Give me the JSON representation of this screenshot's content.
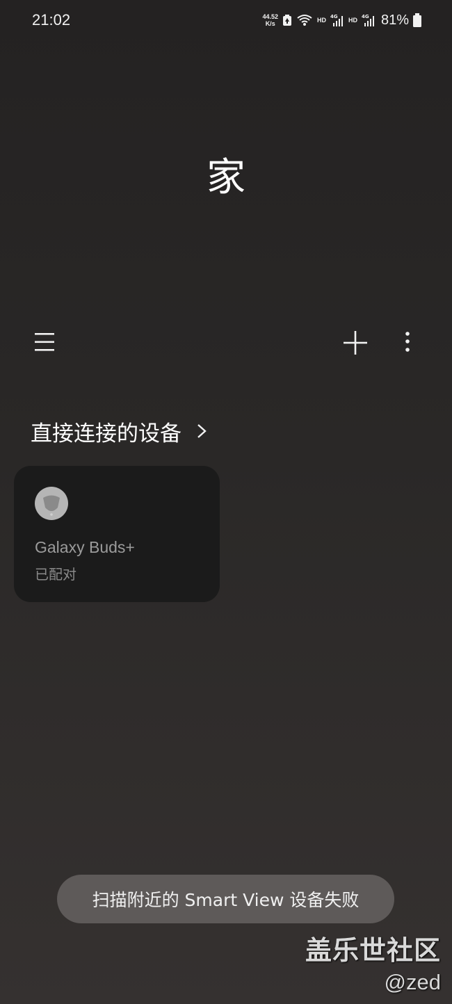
{
  "status_bar": {
    "time": "21:02",
    "net_speed_value": "44.52",
    "net_speed_unit": "K/s",
    "hd1": "HD",
    "hd2": "HD",
    "network1": "4G",
    "network2": "4G",
    "battery_percent": "81%"
  },
  "header": {
    "title": "家"
  },
  "toolbar": {
    "menu_icon": "hamburger-icon",
    "add_icon": "plus-icon",
    "more_icon": "more-vertical-icon"
  },
  "section": {
    "title": "直接连接的设备",
    "chevron_icon": "chevron-right-icon"
  },
  "devices": [
    {
      "name": "Galaxy Buds+",
      "status": "已配对",
      "icon": "earbuds-icon"
    }
  ],
  "toast": {
    "message": "扫描附近的 Smart View 设备失败"
  },
  "watermark": {
    "line1": "盖乐世社区",
    "line2": "@zed"
  },
  "colors": {
    "background_top": "#242222",
    "background_bottom": "#353130",
    "card": "#1b1b1b",
    "toast": "#5e5a59"
  }
}
